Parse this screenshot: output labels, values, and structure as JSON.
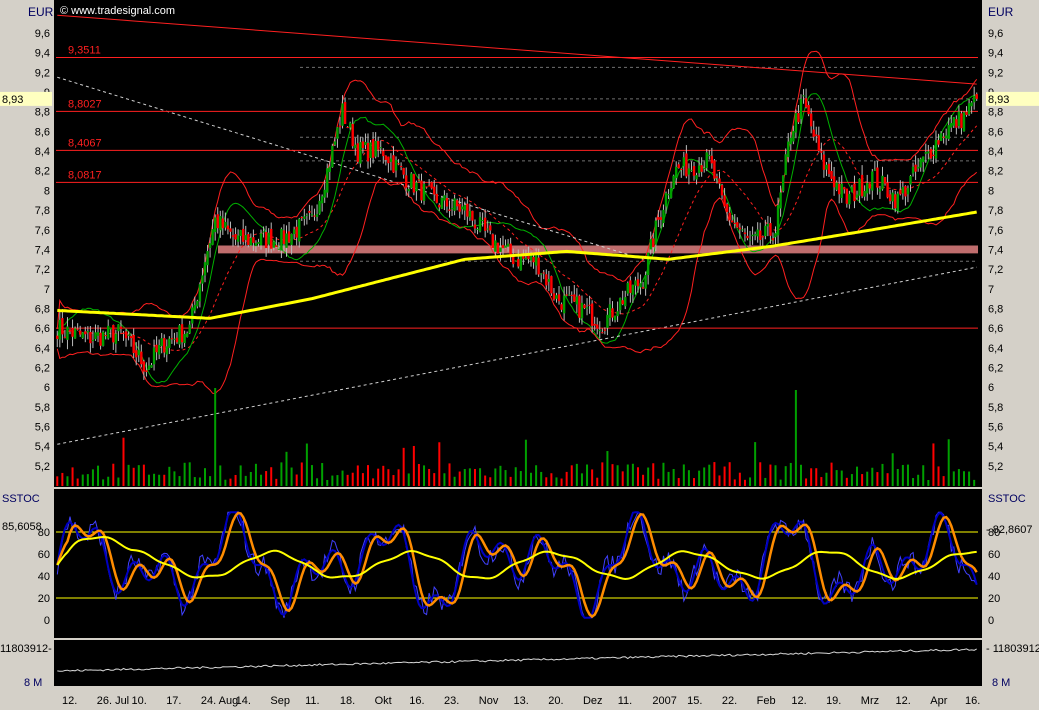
{
  "header": {
    "currency": "EUR",
    "copyright": "© www.tradesignal.com"
  },
  "colors": {
    "bg": "#000000",
    "panel_border": "#c8c8c8",
    "red": "#ff2020",
    "green": "#00b000",
    "candle_up": "#00a000",
    "candle_down": "#ff0000",
    "ma_yellow": "#ffff00",
    "zone": "#e08080",
    "stoch_blue": "#0000c0",
    "stoch_orange": "#ff8c00",
    "stoch_yellow": "#ffff00",
    "label_bg": "#ffffc0"
  },
  "price_axis": {
    "ticks": [
      "9,6",
      "9,4",
      "9,2",
      "9",
      "8,8",
      "8,6",
      "8,4",
      "8,2",
      "8",
      "7,8",
      "7,6",
      "7,4",
      "7,2",
      "7",
      "6,8",
      "6,6",
      "6,4",
      "6,2",
      "6",
      "5,8",
      "5,6",
      "5,4",
      "5,2"
    ],
    "current_label": "8,93"
  },
  "stoch_axis": {
    "ticks": [
      "80",
      "60",
      "40",
      "20",
      "0"
    ],
    "label": "SSTOC",
    "left_value": "85,6058",
    "right_value": "82,8607"
  },
  "volume_axis": {
    "value": "11803912",
    "bottom_label": "8 M"
  },
  "x_labels": [
    "12.",
    "26. Jul",
    "10.",
    "17.",
    "24. Aug",
    "14.",
    "Sep",
    "11.",
    "18.",
    "Okt",
    "16.",
    "23.",
    "Nov",
    "13.",
    "20.",
    "Dez",
    "11.",
    "2007",
    "15.",
    "22.",
    "Feb",
    "12.",
    "19.",
    "Mrz",
    "12.",
    "Apr",
    "16."
  ],
  "chart_data": [
    {
      "type": "candlestick",
      "currency": "EUR",
      "ylim": [
        5.0,
        9.8
      ],
      "horizontal_levels": [
        {
          "label": "9,3511",
          "value": 9.3511
        },
        {
          "label": "8,8027",
          "value": 8.8027
        },
        {
          "label": "8,4067",
          "value": 8.4067
        },
        {
          "label": "8,0817",
          "value": 8.0817
        },
        {
          "label": "",
          "value": 6.6
        }
      ],
      "support_zone": [
        7.36,
        7.44
      ],
      "close_path_keys": [
        [
          0,
          6.6
        ],
        [
          12,
          6.5
        ],
        [
          25,
          6.55
        ],
        [
          35,
          6.2
        ],
        [
          42,
          6.45
        ],
        [
          52,
          6.6
        ],
        [
          58,
          7.3
        ],
        [
          62,
          7.7
        ],
        [
          70,
          7.5
        ],
        [
          88,
          7.5
        ],
        [
          100,
          7.7
        ],
        [
          106,
          8.2
        ],
        [
          112,
          8.8
        ],
        [
          118,
          8.4
        ],
        [
          128,
          8.4
        ],
        [
          138,
          8.1
        ],
        [
          148,
          7.9
        ],
        [
          160,
          7.8
        ],
        [
          170,
          7.5
        ],
        [
          180,
          7.3
        ],
        [
          188,
          7.3
        ],
        [
          196,
          6.9
        ],
        [
          206,
          6.8
        ],
        [
          214,
          6.65
        ],
        [
          222,
          6.9
        ],
        [
          230,
          7.1
        ],
        [
          236,
          7.7
        ],
        [
          242,
          8.2
        ],
        [
          256,
          8.3
        ],
        [
          262,
          7.8
        ],
        [
          272,
          7.45
        ],
        [
          282,
          7.6
        ],
        [
          288,
          8.6
        ],
        [
          293,
          8.9
        ],
        [
          300,
          8.3
        ],
        [
          310,
          7.9
        ],
        [
          320,
          8.15
        ],
        [
          330,
          7.9
        ],
        [
          340,
          8.3
        ],
        [
          348,
          8.6
        ],
        [
          356,
          8.75
        ],
        [
          361,
          8.93
        ]
      ],
      "ma200_keys": [
        [
          0,
          6.78
        ],
        [
          60,
          6.7
        ],
        [
          100,
          6.9
        ],
        [
          160,
          7.3
        ],
        [
          200,
          7.38
        ],
        [
          240,
          7.3
        ],
        [
          280,
          7.43
        ],
        [
          320,
          7.6
        ],
        [
          361,
          7.78
        ]
      ],
      "trendlines": [
        {
          "name": "resistance",
          "from": [
            0,
            9.78
          ],
          "to": [
            361,
            9.08
          ]
        },
        {
          "name": "support",
          "from": [
            0,
            5.42
          ],
          "to": [
            361,
            7.22
          ]
        }
      ]
    },
    {
      "type": "line",
      "title": "SSTOC",
      "ylim": [
        -5,
        100
      ],
      "levels": [
        80,
        20
      ],
      "last": {
        "fast": 82.8607,
        "slow": 85.6058
      }
    },
    {
      "type": "area",
      "title": "Volume",
      "last": 11803912
    }
  ]
}
